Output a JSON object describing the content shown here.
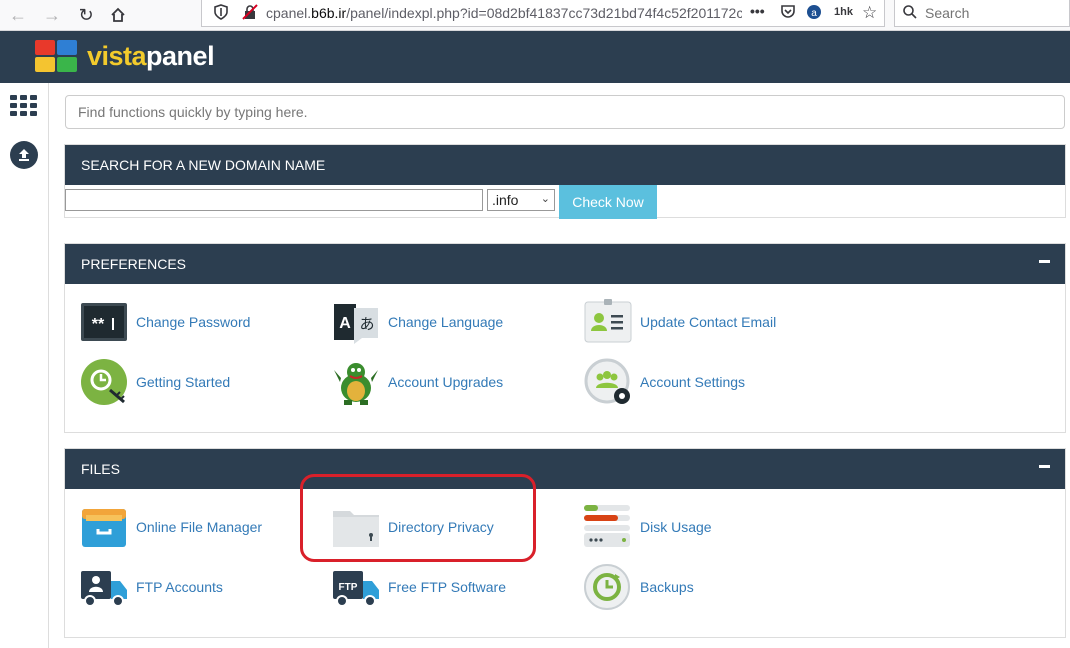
{
  "browser": {
    "url_prefix": "cpanel.",
    "url_domain": "b6b.ir",
    "url_rest": "/panel/indexpl.php?id=08d2bf41837cc73d21bd74f4c52f201172c",
    "more_label": "•••",
    "ext_label": "1hk",
    "search_placeholder": "Search"
  },
  "header": {
    "brand_vista": "vista",
    "brand_panel": "panel"
  },
  "quick_search": {
    "placeholder": "Find functions quickly by typing here."
  },
  "domain_search": {
    "title": "SEARCH FOR A NEW DOMAIN NAME",
    "input_value": "",
    "tld_selected": ".info",
    "button_label": "Check Now"
  },
  "preferences": {
    "title": "PREFERENCES",
    "items": [
      {
        "label": "Change Password",
        "icon": "password-icon"
      },
      {
        "label": "Change Language",
        "icon": "language-icon"
      },
      {
        "label": "Update Contact Email",
        "icon": "contact-icon"
      },
      {
        "label": "Getting Started",
        "icon": "getting-started-icon"
      },
      {
        "label": "Account Upgrades",
        "icon": "dragon-icon"
      },
      {
        "label": "Account Settings",
        "icon": "account-settings-icon"
      }
    ]
  },
  "files": {
    "title": "FILES",
    "items": [
      {
        "label": "Online File Manager",
        "icon": "file-manager-icon"
      },
      {
        "label": "Directory Privacy",
        "icon": "folder-lock-icon"
      },
      {
        "label": "Disk Usage",
        "icon": "disk-usage-icon"
      },
      {
        "label": "FTP Accounts",
        "icon": "ftp-accounts-icon"
      },
      {
        "label": "Free FTP Software",
        "icon": "ftp-software-icon"
      },
      {
        "label": "Backups",
        "icon": "backups-icon"
      }
    ]
  },
  "colors": {
    "header_bg": "#2c3e50",
    "link": "#337ab7",
    "button": "#5bc0de",
    "highlight": "#d9202a"
  }
}
